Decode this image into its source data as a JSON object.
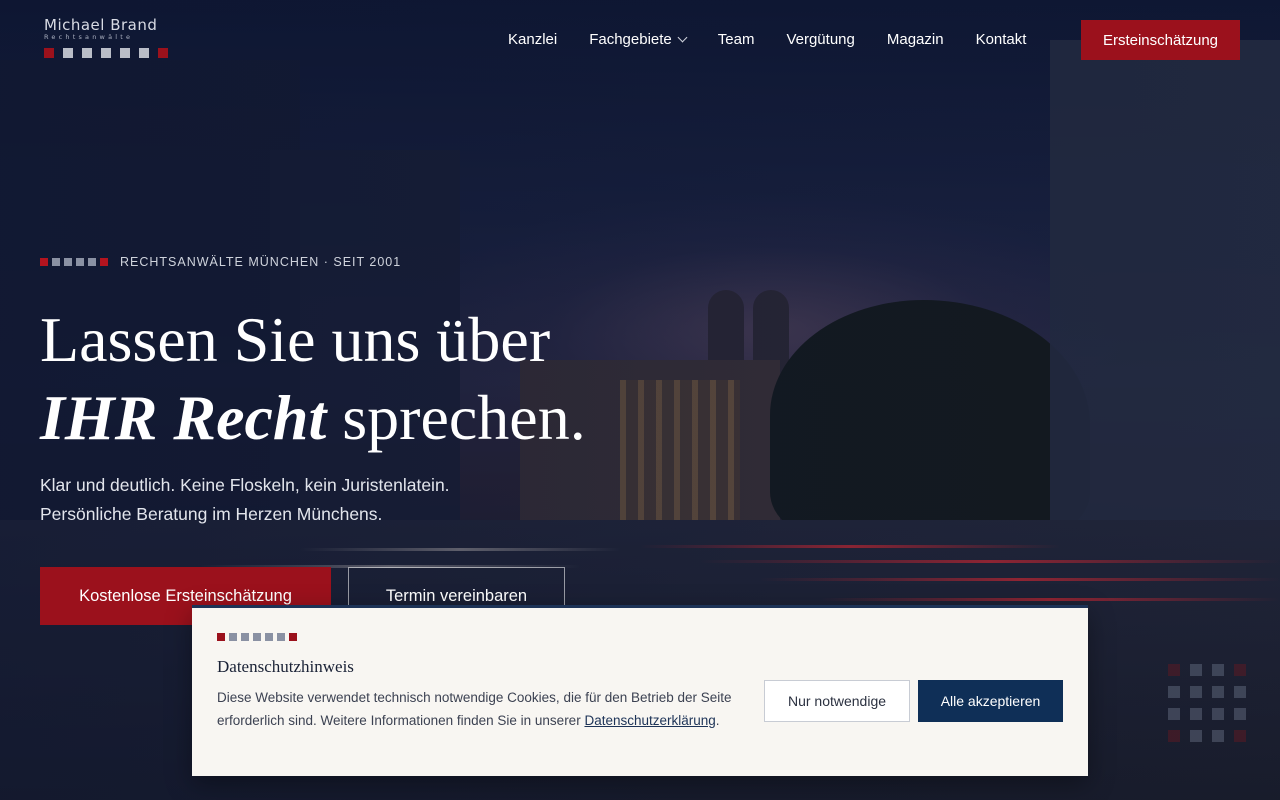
{
  "logo": {
    "name": "Michael Brand",
    "subtitle": "Rechtsanwälte"
  },
  "nav": {
    "items": [
      {
        "label": "Kanzlei"
      },
      {
        "label": "Fachgebiete",
        "has_dropdown": true
      },
      {
        "label": "Team"
      },
      {
        "label": "Vergütung"
      },
      {
        "label": "Magazin"
      },
      {
        "label": "Kontakt"
      }
    ],
    "cta_label": "Ersteinschätzung"
  },
  "hero": {
    "eyebrow": "RECHTSANWÄLTE MÜNCHEN · SEIT 2001",
    "headline_line1": "Lassen Sie uns über",
    "headline_emphasis": "IHR Recht",
    "headline_rest": "sprechen.",
    "lead_line1": "Klar und deutlich. Keine Floskeln, kein Juristenlatein.",
    "lead_line2": "Persönliche Beratung im Herzen Münchens.",
    "primary_button": "Kostenlose Ersteinschätzung",
    "secondary_button": "Termin vereinbaren"
  },
  "cookie": {
    "title": "Datenschutzhinweis",
    "text": "Diese Website verwendet technisch notwendige Cookies, die für den Betrieb der Seite erforderlich sind. Weitere Informationen finden Sie in unserer",
    "link_label": "Datenschutzerklärung",
    "text_end": ".",
    "necessary_button": "Nur notwendige",
    "accept_button": "Alle akzeptieren"
  },
  "colors": {
    "brand_red": "#9b111c",
    "navy": "#0f2f57",
    "banner_bg": "#f8f6f2"
  }
}
